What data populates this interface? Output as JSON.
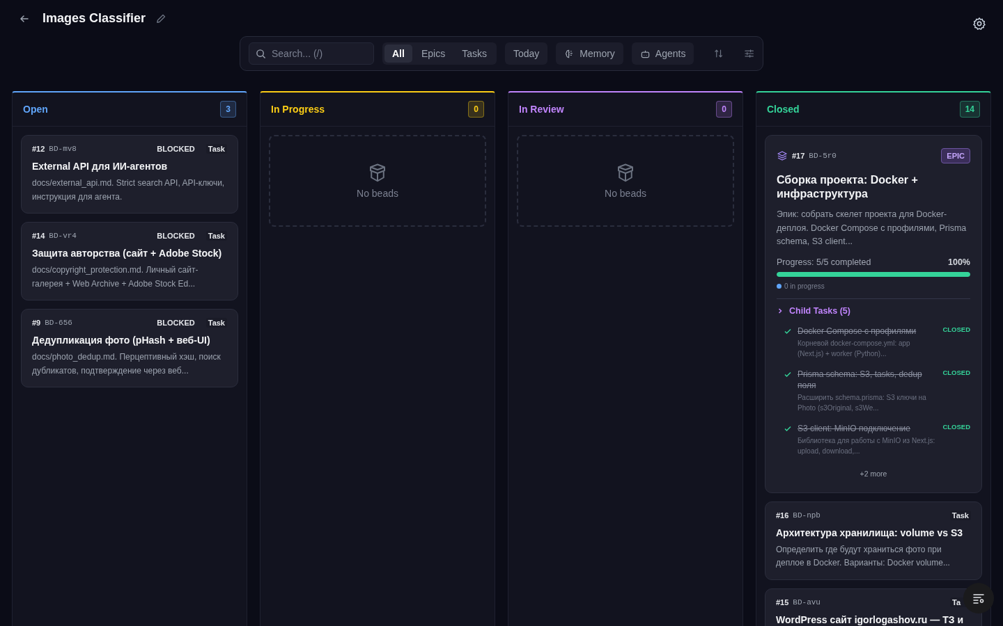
{
  "header": {
    "title": "Images Classifier"
  },
  "toolbar": {
    "search": {
      "placeholder": "Search... (/)"
    },
    "filters": [
      {
        "label": "All",
        "selected": true
      },
      {
        "label": "Epics",
        "selected": false
      },
      {
        "label": "Tasks",
        "selected": false
      }
    ],
    "buttons": [
      {
        "label": "Today",
        "kind": "plain"
      },
      {
        "label": "Memory",
        "kind": "brain"
      },
      {
        "label": "Agents",
        "kind": "robot"
      }
    ]
  },
  "columns": [
    {
      "title": "Open",
      "count": "3",
      "color": "#60a5fa",
      "cards": [
        {
          "kind": "task",
          "number": "#12",
          "key": "BD-mv8",
          "status": "BLOCKED",
          "type": "Task",
          "title": "External API для ИИ-агентов",
          "description": "docs/external_api.md. Strict search API, API-ключи, инструкция для агента."
        },
        {
          "kind": "task",
          "number": "#14",
          "key": "BD-vr4",
          "status": "BLOCKED",
          "type": "Task",
          "title": "Защита авторства (сайт + Adobe Stock)",
          "description": "docs/copyright_protection.md. Личный сайт-галерея + Web Archive + Adobe Stock Ed..."
        },
        {
          "kind": "task",
          "number": "#9",
          "key": "BD-656",
          "status": "BLOCKED",
          "type": "Task",
          "title": "Дедупликация фото (pHash + веб-UI)",
          "description": "docs/photo_dedup.md. Перцептивный хэш, поиск дубликатов, подтверждение через веб..."
        }
      ]
    },
    {
      "title": "In Progress",
      "count": "0",
      "color": "#facc15",
      "empty": "No beads"
    },
    {
      "title": "In Review",
      "count": "0",
      "color": "#c084fc",
      "empty": "No beads"
    },
    {
      "title": "Closed",
      "count": "14",
      "color": "#34d399",
      "cards": [
        {
          "kind": "epic",
          "number": "#17",
          "key": "BD-5r0",
          "type": "EPIC",
          "title": "Сборка проекта: Docker + инфраструктура",
          "description": "Эпик: собрать скелет проекта для Docker-деплоя. Docker Compose с профилями, Prisma schema, S3 client...",
          "progress_label": "Progress: 5/5 completed",
          "percent": "100%",
          "level": 1,
          "in_progress": "0 in progress",
          "children_label": "Child Tasks (5)",
          "expanded": false,
          "children": [
            {
              "title": "Docker Compose с профилями",
              "status": "CLOSED",
              "done": true,
              "description": "Корневой docker-compose.yml: app (Next.js) + worker (Python)..."
            },
            {
              "title": "Prisma schema: S3, tasks, dedup поля",
              "status": "CLOSED",
              "done": true,
              "description": "Расширить schema.prisma: S3 ключи на Photo (s3Original, s3We..."
            },
            {
              "title": "S3 client: MinIO подключение",
              "status": "CLOSED",
              "done": true,
              "description": "Библиотека для работы с MinIO из Next.js: upload, download,..."
            }
          ],
          "more": "+2 more"
        },
        {
          "kind": "task",
          "number": "#16",
          "key": "BD-npb",
          "type": "Task",
          "title": "Архитектура хранилища: volume vs S3",
          "description": "Определить где будут храниться фото при деплое в Docker. Варианты: Docker volume..."
        },
        {
          "kind": "task",
          "number": "#15",
          "key": "BD-avu",
          "type": "Ta",
          "title": "WordPress сайт igorlogashov.ru — ТЗ и"
        }
      ]
    }
  ]
}
